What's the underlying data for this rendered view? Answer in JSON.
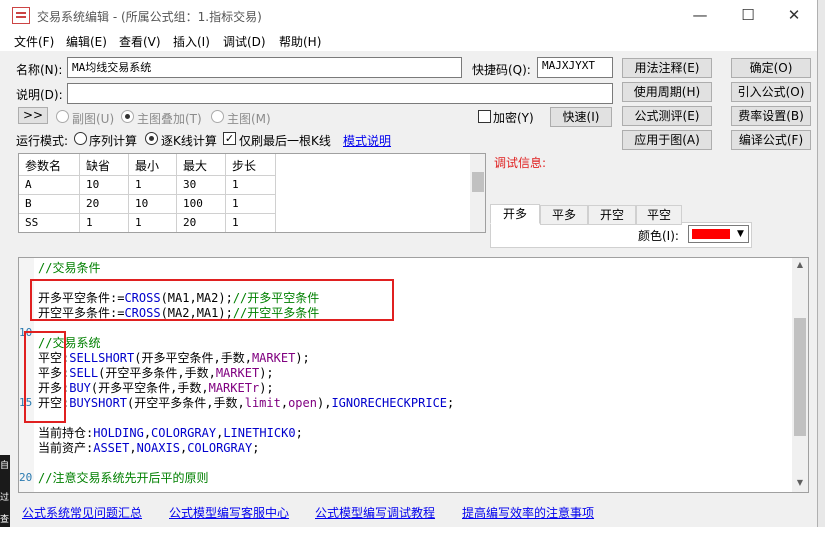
{
  "window": {
    "title": "交易系统编辑 - (所属公式组：1.指标交易)",
    "minimize": "—",
    "maximize": "☐",
    "close": "✕"
  },
  "menu": [
    "文件(F)",
    "编辑(E)",
    "查看(V)",
    "插入(I)",
    "调试(D)",
    "帮助(H)"
  ],
  "form": {
    "name_label": "名称(N):",
    "name_value": "MA均线交易系统",
    "shortcut_label": "快捷码(Q):",
    "shortcut_value": "MAJXJYXT",
    "desc_label": "说明(D):",
    "desc_value": "",
    "expand_button": ">>",
    "radio_subchart": "副图(U)",
    "radio_main_overlay": "主图叠加(T)",
    "radio_main": "主图(M)",
    "encrypt_label": "加密(Y)",
    "quick_button": "快速(I)",
    "run_mode_label": "运行模式:",
    "mode_sequential": "序列计算",
    "mode_per_k": "逐K线计算",
    "only_last_k": "仅刷最后一根K线",
    "mode_help_link": "模式说明"
  },
  "right_buttons": [
    [
      "用法注释(E)",
      "确定(O)"
    ],
    [
      "使用周期(H)",
      "引入公式(O)"
    ],
    [
      "公式测评(E)",
      "费率设置(B)"
    ],
    [
      "应用于图(A)",
      "编译公式(F)"
    ]
  ],
  "params": {
    "headers": [
      "参数名",
      "缺省",
      "最小",
      "最大",
      "步长"
    ],
    "rows": [
      [
        "A",
        "10",
        "1",
        "30",
        "1"
      ],
      [
        "B",
        "20",
        "10",
        "100",
        "1"
      ],
      [
        "SS",
        "1",
        "1",
        "20",
        "1"
      ]
    ]
  },
  "debug": {
    "label": "调试信息:",
    "tabs": [
      "开多",
      "平多",
      "开空",
      "平空"
    ],
    "color_label": "颜色(I):",
    "color_value": "#ff0000"
  },
  "editor": {
    "line_numbers": [
      "10",
      "15",
      "20"
    ],
    "lines": [
      "//交易条件",
      "",
      "开多平空条件:=CROSS(MA1,MA2);//开多平空条件",
      "开空平多条件:=CROSS(MA2,MA1);//开空平多条件",
      "",
      "//交易系统",
      "平空:SELLSHORT(开多平空条件,手数,MARKET);",
      "平多:SELL(开空平多条件,手数,MARKET);",
      "开多:BUY(开多平空条件,手数,MARKETr);",
      "开空:BUYSHORT(开空平多条件,手数,limit,open),IGNORECHECKPRICE;",
      "",
      "当前持仓:HOLDING,COLORGRAY,LINETHICK0;",
      "当前资产:ASSET,NOAXIS,COLORGRAY;",
      "",
      "//注意交易系统先开后平的原则"
    ]
  },
  "footer_links": [
    "公式系统常见问题汇总",
    "公式模型编写客服中心",
    "公式模型编写调试教程",
    "提高编写效率的注意事项"
  ],
  "left_edge": [
    "自",
    "过",
    "查询"
  ]
}
